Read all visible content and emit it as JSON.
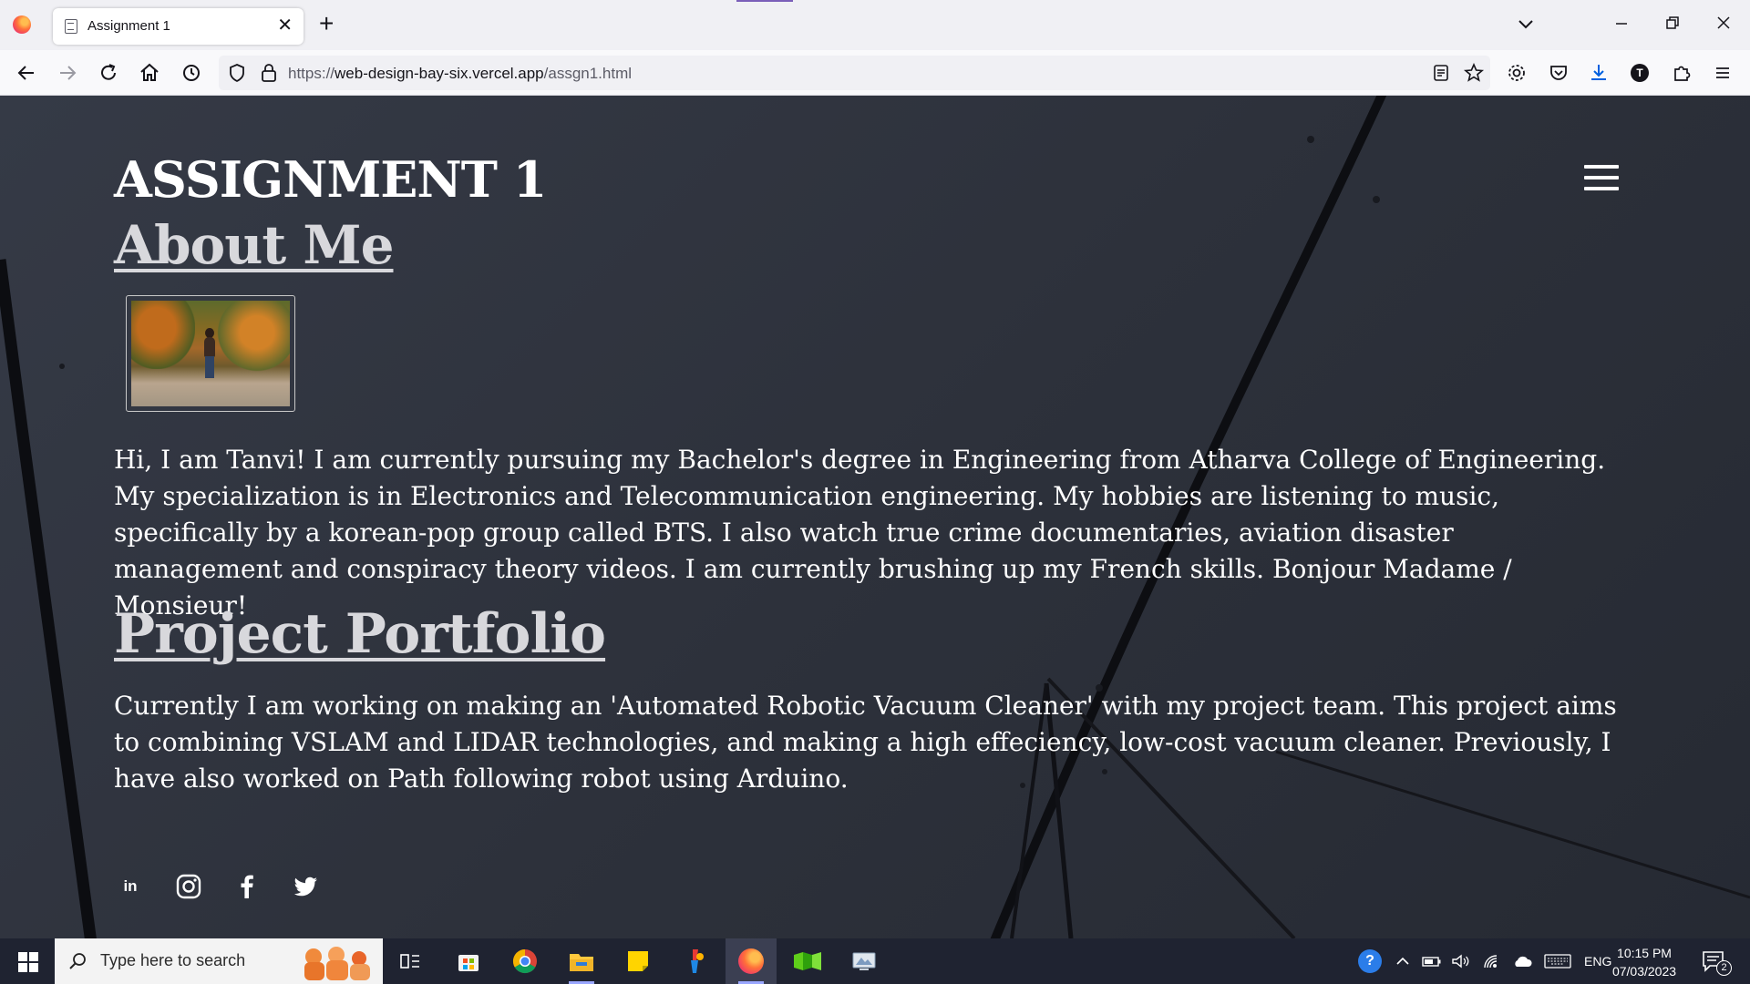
{
  "browser": {
    "tab_title": "Assignment 1",
    "tab_close": "✕",
    "new_tab": "+",
    "url_prefix": "https://",
    "url_host": "web-design-bay-six.vercel.app",
    "url_path": "/assgn1.html"
  },
  "page": {
    "title": "ASSIGNMENT 1",
    "about_heading": "About Me",
    "about_text": "Hi, I am Tanvi! I am currently pursuing my Bachelor's degree in Engineering from Atharva College of Engineering. My specialization is in Electronics and Telecommunication engineering. My hobbies are listening to music, specifically by a korean-pop group called BTS. I also watch true crime documentaries, aviation disaster management and conspiracy theory videos. I am currently brushing up my French skills. Bonjour Madame / Monsieur!",
    "portfolio_heading": "Project Portfolio",
    "portfolio_text": "Currently I am working on making an 'Automated Robotic Vacuum Cleaner' with my project team. This project aims to combining VSLAM and LIDAR technologies, and making a high effeciency, low-cost vacuum cleaner. Previously, I have also worked on Path following robot using Arduino.",
    "socials": [
      "linkedin-icon",
      "instagram-icon",
      "facebook-icon",
      "twitter-icon"
    ]
  },
  "taskbar": {
    "search_placeholder": "Type here to search",
    "language": "ENG",
    "time": "10:15 PM",
    "date": "07/03/2023",
    "notification_count": "2"
  }
}
